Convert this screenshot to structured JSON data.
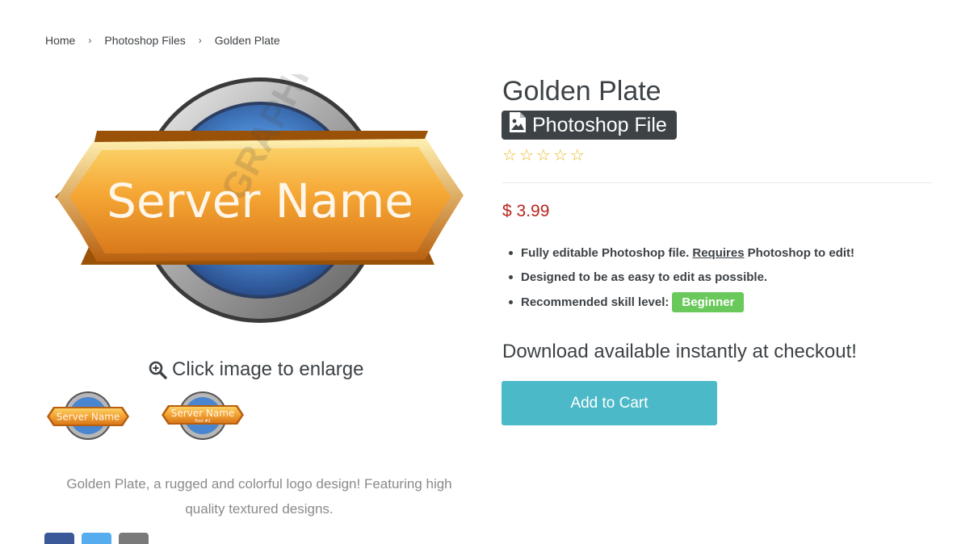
{
  "breadcrumb": {
    "items": [
      "Home",
      "Photoshop Files",
      "Golden Plate"
    ],
    "separator": "›"
  },
  "product": {
    "title": "Golden Plate",
    "badge_label": "Photoshop File",
    "star_glyph": "☆",
    "rating_stars_filled": 0,
    "rating_stars_total": 5,
    "price": "$ 3.99",
    "features": {
      "line1_start": "Fully editable Photoshop file.",
      "line1_underlined": "Requires",
      "line1_end": "Photoshop to edit!",
      "line2": "Designed to be as easy to edit as possible.",
      "line3_label": "Recommended skill level:",
      "skill_badge": "Beginner"
    },
    "download_text": "Download available instantly at checkout!",
    "add_to_cart_label": "Add to Cart",
    "enlarge_hint": "Click image to enlarge",
    "description": "Golden Plate, a rugged and colorful logo design! Featuring high quality textured designs."
  },
  "images": {
    "main_plate_text": "Server Name",
    "watermark_text": "GRAPHICS",
    "thumbs": [
      {
        "plate_text": "Server Name",
        "sub_text": ""
      },
      {
        "plate_text": "Server Name",
        "sub_text": "Post #2"
      }
    ]
  },
  "social": [
    {
      "icon": "facebook-icon",
      "color": "#3b5998"
    },
    {
      "icon": "twitter-icon",
      "color": "#55acee"
    },
    {
      "icon": "email-icon",
      "color": "#7a7a7a"
    }
  ],
  "colors": {
    "price": "#b8261d",
    "skill_badge": "#6ac95b",
    "add_to_cart": "#4cb9c9",
    "badge_bg": "#3d4246",
    "stars": "#e8b825"
  }
}
